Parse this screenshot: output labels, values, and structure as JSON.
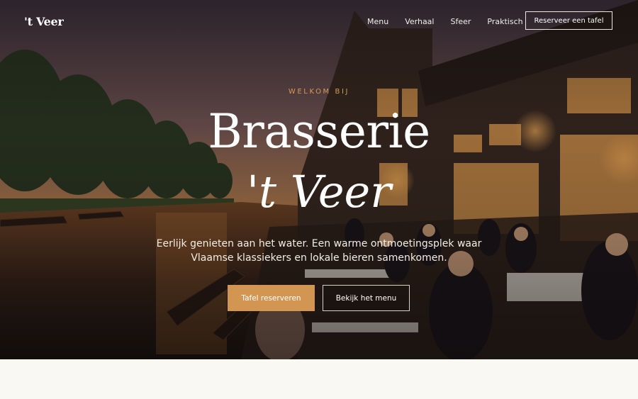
{
  "header": {
    "logo": "'t Veer",
    "nav": [
      {
        "label": "Menu"
      },
      {
        "label": "Verhaal"
      },
      {
        "label": "Sfeer"
      },
      {
        "label": "Praktisch"
      }
    ],
    "cta_label": "Reserveer een tafel"
  },
  "hero": {
    "eyebrow": "WELKOM BIJ",
    "title_line1": "Brasserie",
    "title_line2": "'t Veer",
    "tagline": "Eerlijk genieten aan het water. Een warme ontmoetingsplek waar Vlaamse klassiekers en lokale bieren samenkomen.",
    "primary_button": "Tafel reserveren",
    "secondary_button": "Bekijk het menu",
    "image_description_icon": "canal-terrace-photo"
  },
  "colors": {
    "accent": "#d39652",
    "eyebrow": "#d49a52",
    "page_bg": "#faf8f3"
  }
}
